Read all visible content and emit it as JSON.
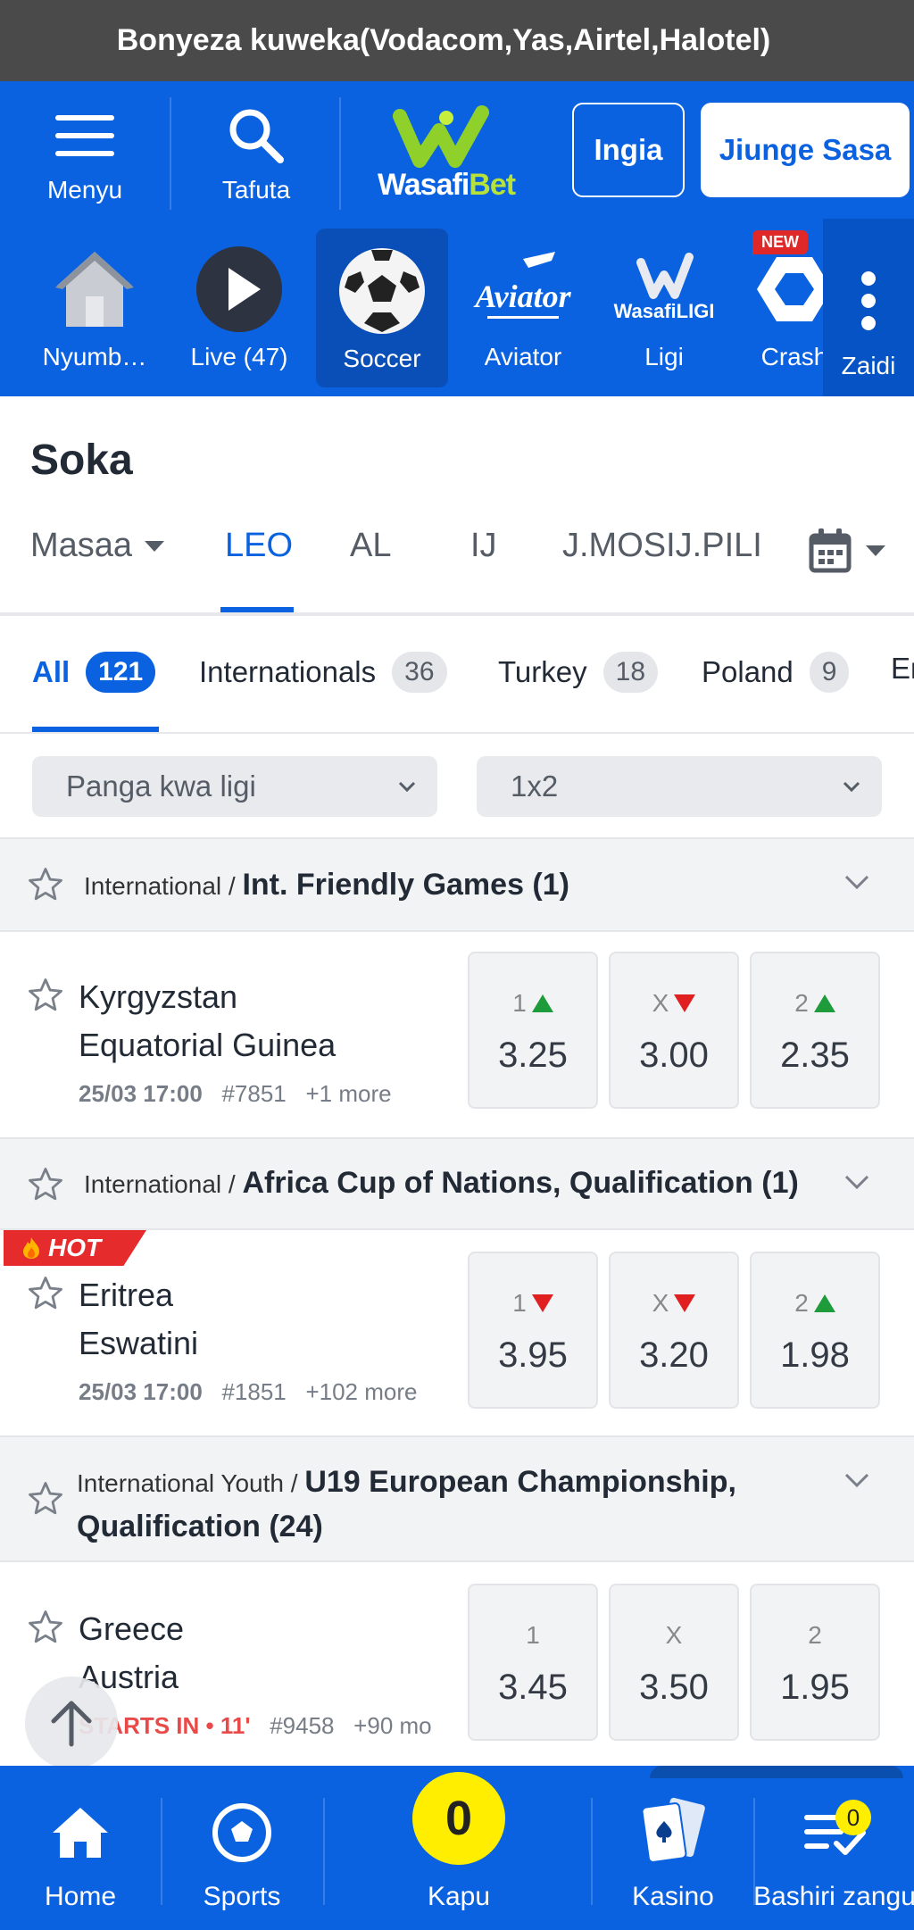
{
  "promo_banner": "Bonyeza kuweka(Vodacom,Yas,Airtel,Halotel)",
  "header": {
    "menu_label": "Menyu",
    "search_label": "Tafuta",
    "logo_text_a": "Wasafi",
    "logo_text_b": "Bet",
    "login_label": "Ingia",
    "join_label": "Jiunge Sasa"
  },
  "nav": {
    "items": [
      {
        "label": "Nyumb…",
        "icon": "home-icon"
      },
      {
        "label": "Live (47)",
        "icon": "play-icon"
      },
      {
        "label": "Soccer",
        "icon": "soccer-ball-icon",
        "active": true
      },
      {
        "label": "Aviator",
        "icon": "aviator-logo-icon",
        "logo_text": "Aviator"
      },
      {
        "label": "Ligi",
        "icon": "wasafi-ligi-icon",
        "logo_text": "WasafiLIGI"
      },
      {
        "label": "Crash",
        "icon": "crash-icon"
      }
    ],
    "new_badge": "NEW",
    "more_label": "Zaidi"
  },
  "page_title": "Soka",
  "filter_tabs": {
    "games": "Masaa",
    "today": "LEO",
    "tomorrow": "AL",
    "friday": "IJ",
    "weekend": "J.MOSIJ.PILI"
  },
  "category_tabs": [
    {
      "label": "All",
      "count": "121"
    },
    {
      "label": "Internationals",
      "count": "36"
    },
    {
      "label": "Turkey",
      "count": "18"
    },
    {
      "label": "Poland",
      "count": "9"
    },
    {
      "label": "En",
      "count": ""
    }
  ],
  "selects": {
    "sort": "Panga kwa ligi",
    "market": "1x2"
  },
  "leagues": [
    {
      "region": "International / ",
      "name": "Int. Friendly Games (1)"
    },
    {
      "region": "International / ",
      "name": "Africa Cup of Nations, Qualification (1)"
    },
    {
      "region": "International Youth / ",
      "name": "U19 European Championship,",
      "name2": "Qualification (24)"
    }
  ],
  "matches": [
    {
      "home": "Kyrgyzstan",
      "away": "Equatorial Guinea",
      "datetime": "25/03 17:00",
      "id": "#7851",
      "more": "+1 more",
      "odds": [
        {
          "label": "1",
          "value": "3.25",
          "trend": "up"
        },
        {
          "label": "X",
          "value": "3.00",
          "trend": "down"
        },
        {
          "label": "2",
          "value": "2.35",
          "trend": "up"
        }
      ]
    },
    {
      "home": "Eritrea",
      "away": "Eswatini",
      "datetime": "25/03 17:00",
      "id": "#1851",
      "more": "+102 more",
      "hot": "HOT",
      "odds": [
        {
          "label": "1",
          "value": "3.95",
          "trend": "down"
        },
        {
          "label": "X",
          "value": "3.20",
          "trend": "down"
        },
        {
          "label": "2",
          "value": "1.98",
          "trend": "up"
        }
      ]
    },
    {
      "home": "Greece",
      "away": "Austria",
      "starts_in": "STARTS IN • 11'",
      "id": "#9458",
      "more": "+90 mo",
      "odds": [
        {
          "label": "1",
          "value": "3.45"
        },
        {
          "label": "X",
          "value": "3.50"
        },
        {
          "label": "2",
          "value": "1.95"
        }
      ]
    }
  ],
  "bottom_nav": {
    "home": "Home",
    "sports": "Sports",
    "betslip": "Kapu",
    "betslip_count": "0",
    "casino": "Kasino",
    "mybets": "Bashiri zangu",
    "mybets_count": "0"
  },
  "colors": {
    "brand_blue": "#0a62e0",
    "up": "#1e9b3a",
    "down": "#e02020",
    "hot": "#e52b2b",
    "betslip": "#ffee00"
  }
}
